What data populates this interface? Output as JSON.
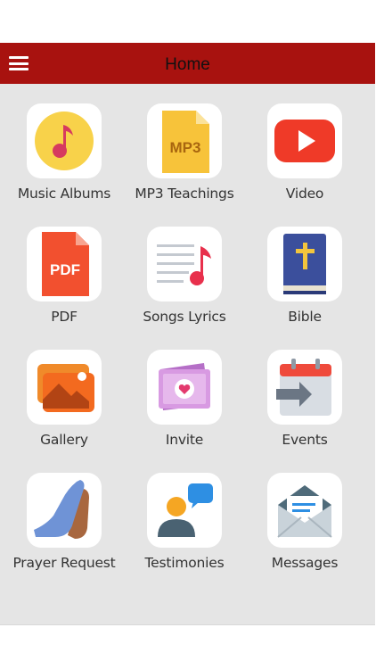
{
  "app_bar": {
    "title": "Home",
    "background": "#a8120f",
    "menu_icon": "hamburger-menu-icon"
  },
  "tiles": [
    {
      "label": "Music Albums",
      "icon": "music-note-icon"
    },
    {
      "label": "MP3 Teachings",
      "icon": "mp3-file-icon",
      "icon_text": "MP3"
    },
    {
      "label": "Video",
      "icon": "video-play-icon"
    },
    {
      "label": "PDF",
      "icon": "pdf-file-icon",
      "icon_text": "PDF"
    },
    {
      "label": "Songs Lyrics",
      "icon": "lyrics-icon"
    },
    {
      "label": "Bible",
      "icon": "bible-icon"
    },
    {
      "label": "Gallery",
      "icon": "gallery-icon"
    },
    {
      "label": "Invite",
      "icon": "invite-icon"
    },
    {
      "label": "Events",
      "icon": "calendar-icon"
    },
    {
      "label": "Prayer Request",
      "icon": "praying-hands-icon"
    },
    {
      "label": "Testimonies",
      "icon": "testimonies-icon"
    },
    {
      "label": "Messages",
      "icon": "envelope-icon"
    }
  ]
}
